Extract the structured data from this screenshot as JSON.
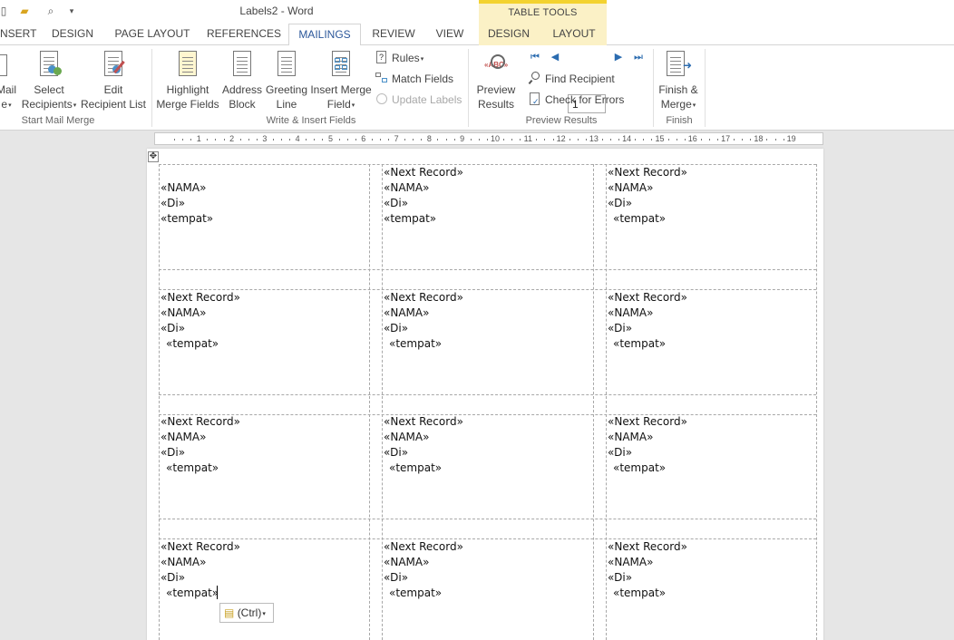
{
  "window": {
    "title": "Labels2 - Word",
    "context_tab_group": "TABLE TOOLS"
  },
  "tabs": [
    "NSERT",
    "DESIGN",
    "PAGE LAYOUT",
    "REFERENCES",
    "MAILINGS",
    "REVIEW",
    "VIEW",
    "DESIGN",
    "LAYOUT"
  ],
  "active_tab": "MAILINGS",
  "ribbon": {
    "start_mail_merge": {
      "label": "Start Mail Merge",
      "mail_line1": "Mail",
      "mail_line2": "e",
      "select_line1": "Select",
      "select_line2": "Recipients",
      "edit_line1": "Edit",
      "edit_line2": "Recipient List"
    },
    "write_insert": {
      "label": "Write & Insert Fields",
      "highlight_line1": "Highlight",
      "highlight_line2": "Merge Fields",
      "address_line1": "Address",
      "address_line2": "Block",
      "greeting_line1": "Greeting",
      "greeting_line2": "Line",
      "insert_line1": "Insert Merge",
      "insert_line2": "Field",
      "rules": "Rules",
      "match_fields": "Match Fields",
      "update_labels": "Update Labels"
    },
    "preview": {
      "label": "Preview Results",
      "preview_line1": "Preview",
      "preview_line2": "Results",
      "record_value": "1",
      "find_recipient": "Find Recipient",
      "check_errors": "Check for Errors"
    },
    "finish": {
      "label": "Finish",
      "finish_line1": "Finish &",
      "finish_line2": "Merge"
    }
  },
  "ruler_numbers": [
    "1",
    "2",
    "3",
    "4",
    "5",
    "6",
    "7",
    "8",
    "9",
    "10",
    "11",
    "12",
    "13",
    "14",
    "15",
    "16",
    "17",
    "18",
    "19"
  ],
  "labels": {
    "next_record": "«Next Record»",
    "nama": "«NAMA»",
    "di": "«Di»",
    "tempat": "«tempat»"
  },
  "paste_options": "(Ctrl)"
}
